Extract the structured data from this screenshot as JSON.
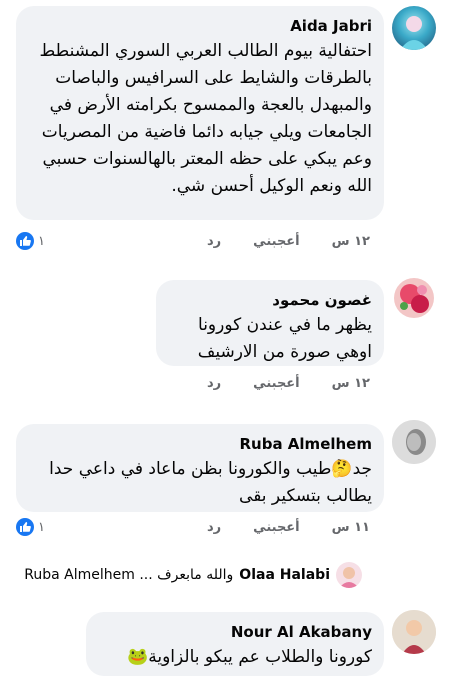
{
  "comments": [
    {
      "author": "Aida Jabri",
      "text": "احتفالية بيوم الطالب العربي السوري المشنطط بالطرقات والشايط على السرافيس والباصات والمبهدل بالعجة والممسوح بكرامته الأرض في الجامعات ويلي جيابه دائما فاضية من المصريات وعم يبكي على حظه المعتر بالهالسنوات حسبي الله ونعم الوكيل أحسن شي.",
      "time": "١٢ س",
      "like": "أعجبني",
      "reply": "رد",
      "reactions": "١"
    },
    {
      "author": "غصون محمود",
      "text": "يظهر ما في عندن كورونا اوهي صورة من الارشيف",
      "time": "١٢ س",
      "like": "أعجبني",
      "reply": "رد"
    },
    {
      "author": "Ruba Almelhem",
      "text": "جد🤔طيب والكورونا بظن ماعاد في داعي حدا يطالب بتسكير بقى",
      "time": "١١ س",
      "like": "أعجبني",
      "reply": "رد",
      "reactions": "١"
    },
    {
      "author": "Nour Al Akabany",
      "text": "كورونا والطلاب عم يبكو بالزاوية🐸"
    }
  ],
  "reply_preview": {
    "author": "Olaa Halabi",
    "text": "والله مابعرف ... Ruba Almelhem"
  }
}
